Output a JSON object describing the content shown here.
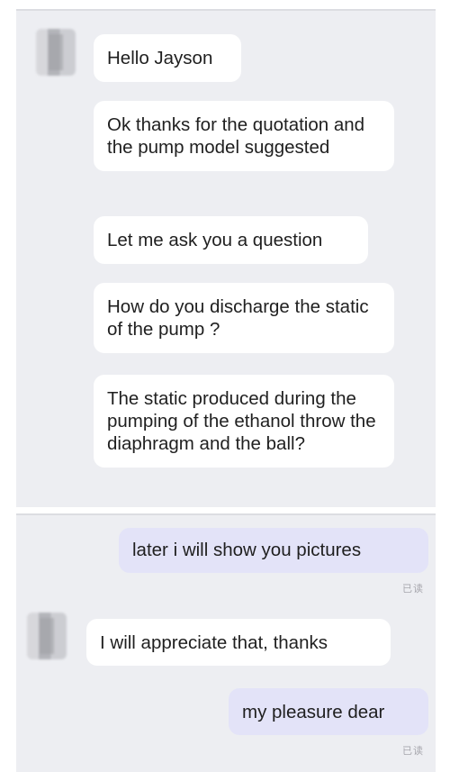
{
  "received_block_1": [
    "Hello Jayson",
    "Ok thanks for the quotation and the pump model suggested",
    "Let me ask you a question",
    "How do you discharge the static of the pump ?",
    "The static produced during the pumping of the ethanol throw the diaphragm and the ball?"
  ],
  "sent_1": {
    "text": "later i will show you pictures",
    "status": "已读"
  },
  "received_2": "I will appreciate that, thanks",
  "sent_2": {
    "text": "my pleasure dear",
    "status": "已读"
  }
}
